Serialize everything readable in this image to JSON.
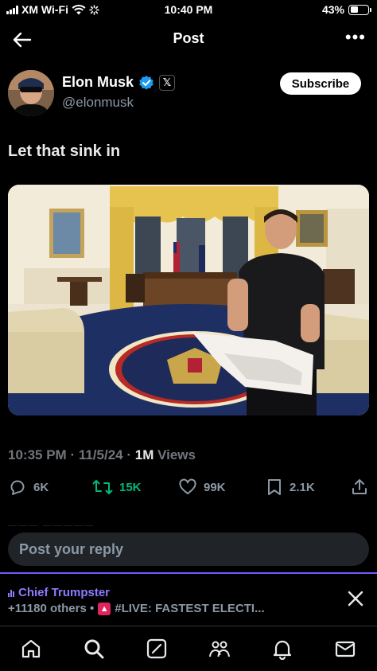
{
  "status_bar": {
    "carrier": "XM Wi-Fi",
    "time": "10:40 PM",
    "battery": "43%",
    "battery_level": 0.43
  },
  "header": {
    "title": "Post"
  },
  "author": {
    "name": "Elon Musk",
    "handle": "@elonmusk",
    "badge_letter": "𝕏",
    "subscribe_label": "Subscribe"
  },
  "post": {
    "text": "Let that sink in",
    "time": "10:35 PM",
    "date": "11/5/24",
    "views_count": "1M",
    "views_label": "Views"
  },
  "actions": {
    "replies": "6K",
    "reposts": "15K",
    "likes": "99K",
    "bookmarks": "2.1K"
  },
  "reply_box": {
    "placeholder": "Post your reply"
  },
  "live_space": {
    "host": "Chief Trumpster",
    "others": "+11180 others •",
    "title": "#LIVE: FASTEST ELECTI..."
  },
  "colors": {
    "accent_repost": "#00ba7c",
    "space_purple": "#7856ff",
    "verified_blue": "#1d9bf0"
  }
}
